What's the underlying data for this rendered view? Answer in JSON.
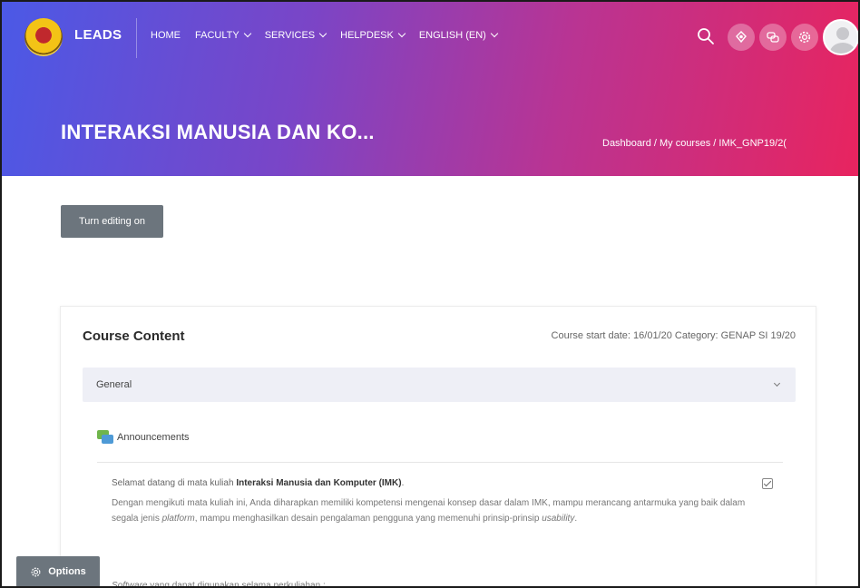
{
  "brand": "LEADS",
  "nav": {
    "items": [
      {
        "label": "HOME",
        "dropdown": false
      },
      {
        "label": "FACULTY",
        "dropdown": true
      },
      {
        "label": "SERVICES",
        "dropdown": true
      },
      {
        "label": "HELPDESK",
        "dropdown": true
      },
      {
        "label": "ENGLISH (EN)",
        "dropdown": true
      }
    ],
    "icons": [
      "search-icon",
      "notifications-icon",
      "messages-icon",
      "settings-icon",
      "user-avatar"
    ]
  },
  "header": {
    "course_title": "INTERAKSI MANUSIA DAN KO...",
    "breadcrumb": "Dashboard / My courses / IMK_GNP19/2("
  },
  "editing_button": "Turn editing on",
  "course_content": {
    "title": "Course Content",
    "meta": "Course start date: 16/01/20   Category: GENAP SI 19/20",
    "section": "General",
    "activity": "Announcements",
    "welcome_prefix": "Selamat datang di mata kuliah ",
    "welcome_bold": "Interaksi Manusia dan Komputer (IMK)",
    "welcome_suffix": ".",
    "para_1": "Dengan mengikuti mata kuliah ini, Anda diharapkan memiliki kompetensi mengenai konsep dasar dalam IMK, mampu merancang antarmuka yang baik dalam segala jenis ",
    "para_italic_1": "platform",
    "para_2": ", mampu menghasilkan desain pengalaman pengguna yang memenuhi prinsip-prinsip ",
    "para_italic_2": "usability",
    "para_3": ".",
    "software_italic": "Software",
    "software_rest": " yang dapat digunakan selama perkuliahan :"
  },
  "options_button": "Options",
  "colors": {
    "gradient_start": "#4b59e6",
    "gradient_end": "#e8245f",
    "button_gray": "#6c757d"
  }
}
